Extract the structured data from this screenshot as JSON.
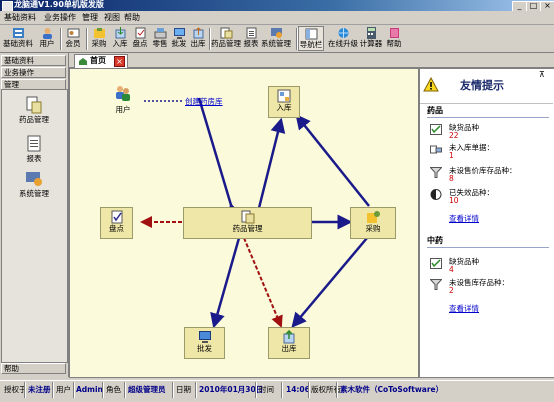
{
  "window": {
    "title": "龙脑通V1.90单机版发版"
  },
  "menu": [
    "基础资料",
    "业务操作",
    "管理",
    "视图",
    "帮助"
  ],
  "toolbar": [
    {
      "label": "基础资料",
      "icon": "basic-data-icon"
    },
    {
      "label": "用户",
      "icon": "user-icon"
    },
    {
      "label": "会员",
      "icon": "member-icon"
    },
    {
      "label": "采购",
      "icon": "purchase-icon"
    },
    {
      "label": "入库",
      "icon": "stock-in-icon"
    },
    {
      "label": "盘点",
      "icon": "inventory-check-icon"
    },
    {
      "label": "零售",
      "icon": "retail-icon"
    },
    {
      "label": "批发",
      "icon": "wholesale-icon"
    },
    {
      "label": "出库",
      "icon": "stock-out-icon"
    },
    {
      "label": "药品管理",
      "icon": "drug-management-icon"
    },
    {
      "label": "报表",
      "icon": "report-icon"
    },
    {
      "label": "系统管理",
      "icon": "system-management-icon"
    },
    {
      "label": "导航栏",
      "icon": "navbar-icon"
    },
    {
      "label": "在线升级",
      "icon": "online-upgrade-icon"
    },
    {
      "label": "计算器",
      "icon": "calculator-icon"
    },
    {
      "label": "帮助",
      "icon": "help-icon"
    }
  ],
  "left_panel": {
    "sections": [
      "基础资料",
      "业务操作",
      "管理"
    ],
    "items": [
      {
        "label": "药品管理",
        "icon": "drug-management-icon"
      },
      {
        "label": "报表",
        "icon": "report-icon"
      },
      {
        "label": "系统管理",
        "icon": "system-management-icon"
      }
    ],
    "bottom": "帮助"
  },
  "tab": {
    "label": "首页"
  },
  "workflow": {
    "nodes": {
      "user": "用户",
      "stock_in": "入库",
      "inventory": "盘点",
      "drug_mgmt": "药品管理",
      "purchase": "采购",
      "wholesale": "批发",
      "stock_out": "出库"
    },
    "create_link": "创建药房库"
  },
  "tips": {
    "title": "友情提示",
    "western": {
      "title": "药品",
      "items": [
        {
          "label": "缺货品种",
          "value": "22",
          "icon": "shortage-icon"
        },
        {
          "label": "未入库单据：",
          "value": "1",
          "icon": "unstocked-doc-icon"
        },
        {
          "label": "未设售价库存品种：",
          "value": "8",
          "icon": "no-price-icon"
        },
        {
          "label": "已失效品种：",
          "value": "10",
          "icon": "expired-icon"
        }
      ],
      "link": "查看详情"
    },
    "chinese": {
      "title": "中药",
      "items": [
        {
          "label": "缺货品种",
          "value": "4",
          "icon": "shortage-icon"
        },
        {
          "label": "未设售库存品种：",
          "value": "2",
          "icon": "no-price-icon"
        }
      ],
      "link": "查看详情"
    }
  },
  "status": {
    "licensed_label": "授权于",
    "licensed_value": "未注册",
    "user_label": "用户",
    "user_value": "Admin",
    "role_label": "角色",
    "role_value": "超级管理员",
    "date_label": "日期",
    "date_value": "2010年01月30日",
    "time_label": "时间",
    "time_value": "14:06",
    "copyright_label": "版权所有",
    "copyright_value": "素木软件（CoToSoftware）"
  }
}
